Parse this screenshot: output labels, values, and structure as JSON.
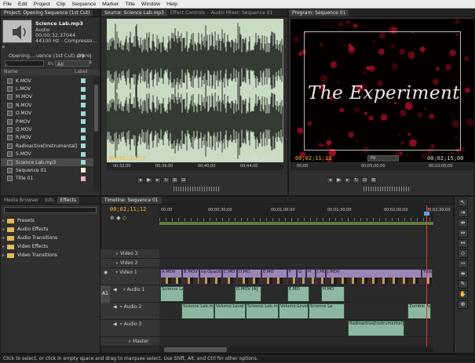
{
  "menu": [
    "File",
    "Edit",
    "Project",
    "Clip",
    "Sequence",
    "Marker",
    "Title",
    "Window",
    "Help"
  ],
  "project": {
    "tab": "Project: Opening Sequence (1st Cut)",
    "clip_name": "Science Lab.mp3",
    "clip_type": "Audio",
    "clip_duration": "00;00;32;37044",
    "clip_format": "44100 Hz - Compresso...",
    "project_file": "Opening....uence (1st Cut).prproj",
    "item_count": "29 Items",
    "in_label": "In:",
    "in_value": "All",
    "col_name": "Name",
    "col_label": "Label",
    "items": [
      {
        "name": "K.MOV",
        "color": "#9fd8cc"
      },
      {
        "name": "L.MOV",
        "color": "#9fd8cc"
      },
      {
        "name": "M.MOV",
        "color": "#9fd8cc"
      },
      {
        "name": "N.MOV",
        "color": "#9fd8cc"
      },
      {
        "name": "O.MOV",
        "color": "#9fd8cc"
      },
      {
        "name": "P.MOV",
        "color": "#9fd8cc"
      },
      {
        "name": "Q.MOV",
        "color": "#9fd8cc"
      },
      {
        "name": "R.MOV",
        "color": "#9fd8cc"
      },
      {
        "name": "Radioactive[Instrumental]",
        "color": "#9fd8cc"
      },
      {
        "name": "S.MOV",
        "color": "#9fd8cc"
      },
      {
        "name": "Science Lab.mp3",
        "color": "#9fd8cc"
      },
      {
        "name": "Sequence 01",
        "color": "#f1f1d0"
      },
      {
        "name": "Title 01",
        "color": "#e3b4c4"
      }
    ]
  },
  "source": {
    "tabs": [
      "Source: Science Lab.mp3",
      "Effect Controls",
      "Audio Mixer: Sequence 01"
    ],
    "timecode_left": "00;00;31;07",
    "timecode_right": "00;00;32;24",
    "ruler": [
      "00;32;00",
      "00;36;00",
      "00;40;00",
      "00;44;00"
    ]
  },
  "program": {
    "tab": "Program: Sequence 01",
    "title_text": "The Experiment",
    "timecode_left": "00;02;11;12",
    "fit": "Fit",
    "timecode_right": "00;02;15;00",
    "ruler": [
      "00;00",
      "00;05;00;00",
      "00;10;00;00"
    ]
  },
  "effects": {
    "tabs": [
      "Media Browser",
      "Info",
      "Effects"
    ],
    "folders": [
      "Presets",
      "Audio Effects",
      "Audio Transitions",
      "Video Effects",
      "Video Transitions"
    ]
  },
  "timeline": {
    "tab": "Timeline: Sequence 01",
    "timecode": "00;02;11;12",
    "ruler": [
      "00;00",
      "00;00;30;00",
      "00;01;00;00",
      "00;01;30;00",
      "00;02;00;00",
      "00;02;30;00"
    ],
    "tracks": {
      "v3": "Video 3",
      "v2": "Video 2",
      "v1": "Video 1",
      "a1": "Audio 1",
      "a2": "Audio 2",
      "a3": "Audio 3",
      "master": "Master",
      "a1_badge": "A1"
    },
    "v1_clips": [
      "A.MOV",
      "B.MOV",
      "ity:Opacity",
      "C.MO",
      "D.MO",
      "E.MO",
      "F",
      "G",
      "H",
      "I.MO",
      "J.MOV",
      "Title"
    ],
    "a1_clips": [
      "Science La",
      "D.MOV [A]",
      "E.MO",
      "H.MO"
    ],
    "a2_clips": [
      "Science Lab.mp3",
      "Volume:Level",
      "Science Lab.mp3",
      "Volume:Level",
      "Science La",
      "Zombie Apoc"
    ],
    "a3_clips": [
      "Radioactive[Instrumental].m"
    ]
  },
  "status": "Click to select, or click in empty space and drag to marquee select. Use Shift, Alt, and Ctrl for other options."
}
